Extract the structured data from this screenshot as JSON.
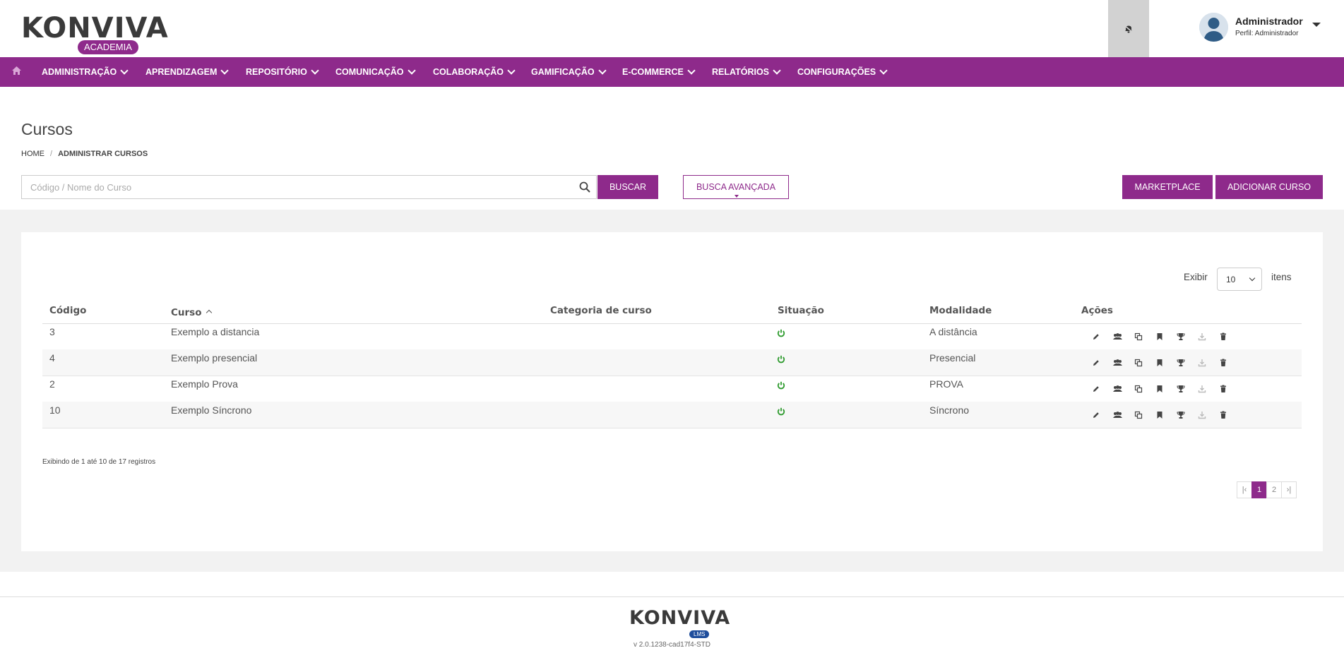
{
  "header": {
    "logo": {
      "text": "KONVIVA",
      "badge": "ACADEMIA"
    },
    "notification_icon": "bell-off-icon",
    "user": {
      "name": "Administrador",
      "profile": "Perfil: Administrador"
    }
  },
  "nav": {
    "home_icon": "home-icon",
    "items": [
      {
        "label": "ADMINISTRAÇÃO"
      },
      {
        "label": "APRENDIZAGEM"
      },
      {
        "label": "REPOSITÓRIO"
      },
      {
        "label": "COMUNICAÇÃO"
      },
      {
        "label": "COLABORAÇÃO"
      },
      {
        "label": "GAMIFICAÇÃO"
      },
      {
        "label": "E-COMMERCE"
      },
      {
        "label": "RELATÓRIOS"
      },
      {
        "label": "CONFIGURAÇÕES"
      }
    ]
  },
  "page": {
    "title": "Cursos",
    "breadcrumb": {
      "home": "HOME",
      "separator": "/",
      "current": "ADMINISTRAR CURSOS"
    }
  },
  "search": {
    "placeholder": "Código / Nome do Curso",
    "value": "",
    "buscar_label": "BUSCAR",
    "advanced_label": "BUSCA AVANÇADA",
    "marketplace_label": "MARKETPLACE",
    "add_course_label": "ADICIONAR CURSO"
  },
  "table": {
    "show_label": "Exibir",
    "page_size": "10",
    "items_label": "itens",
    "headers": {
      "code": "Código",
      "course": "Curso",
      "category": "Categoria de curso",
      "status": "Situação",
      "modality": "Modalidade",
      "actions": "Ações"
    },
    "rows": [
      {
        "code": "3",
        "course": "Exemplo a distancia",
        "category": "",
        "modality": "A distância"
      },
      {
        "code": "4",
        "course": "Exemplo presencial",
        "category": "",
        "modality": "Presencial"
      },
      {
        "code": "2",
        "course": "Exemplo Prova",
        "category": "",
        "modality": "PROVA"
      },
      {
        "code": "10",
        "course": "Exemplo Síncrono",
        "category": "",
        "modality": "Síncrono"
      }
    ],
    "action_icons": [
      "pencil-icon",
      "users-icon",
      "copy-icon",
      "bookmark-icon",
      "trophy-icon",
      "download-icon",
      "trash-icon"
    ],
    "records_text": "Exibindo de 1 até 10 de 17 registros",
    "pagination": {
      "first": "|‹",
      "pages": [
        "1",
        "2"
      ],
      "current": "1",
      "last": "›|"
    }
  },
  "footer": {
    "logo": "KONVIVA",
    "badge": "LMS",
    "version": "v 2.0.1238-cad17f4-STD"
  },
  "colors": {
    "brand": "#8e2a8b",
    "status_active": "#2e9b2e",
    "lms_badge": "#1f4e9c"
  }
}
